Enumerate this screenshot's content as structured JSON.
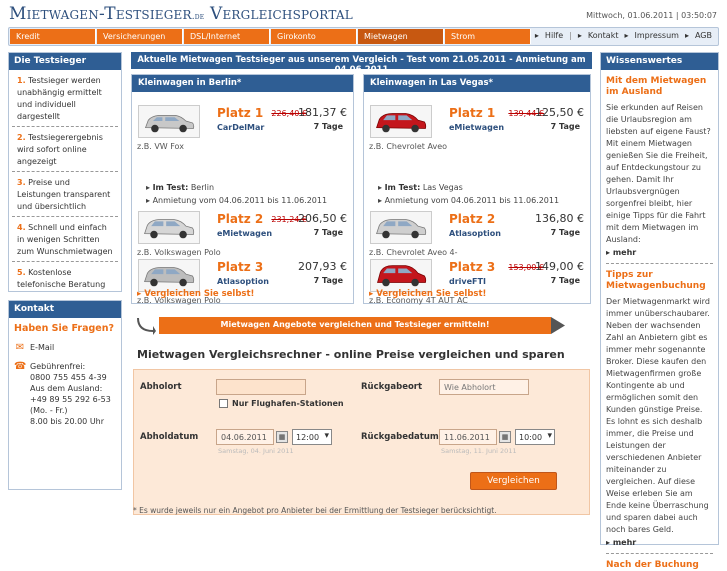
{
  "header": {
    "logo_main": "Mietwagen-Testsieger",
    "logo_tld": ".de",
    "logo_suffix": "Vergleichsportal",
    "datetime": "Mittwoch, 01.06.2011 | 03:50:07"
  },
  "nav": {
    "tabs": [
      "Kredit",
      "Versicherungen",
      "DSL/Internet",
      "Girokonto",
      "Mietwagen",
      "Strom"
    ],
    "active": "Mietwagen",
    "util": [
      "Hilfe",
      "Kontakt",
      "Impressum",
      "AGB"
    ]
  },
  "left": {
    "testsieger_title": "Die Testsieger",
    "tips": [
      {
        "num": "1.",
        "text": "Testsieger werden unabhängig ermittelt und individuell dargestellt"
      },
      {
        "num": "2.",
        "text": "Testsiegerergebnis wird sofort online angezeigt"
      },
      {
        "num": "3.",
        "text": "Preise und Leistungen transparent und übersichtlich"
      },
      {
        "num": "4.",
        "text": "Schnell und einfach in wenigen Schritten zum Wunschmietwagen"
      },
      {
        "num": "5.",
        "text": "Kostenlose telefonische Beratung"
      }
    ],
    "kontakt_title": "Kontakt",
    "question": "Haben Sie Fragen?",
    "email": "E-Mail",
    "phone": "Gebührenfrei:\n0800 755 455 4-39\nAus dem Ausland:\n+49 89 55 292 6-53\n(Mo. - Fr.)\n8.00 bis 20.00 Uhr"
  },
  "main": {
    "heading": "Aktuelle Mietwagen Testsieger aus unserem Vergleich - Test vom 21.05.2011 - Anmietung am 04.06.2011",
    "panels": [
      {
        "title": "Kleinwagen in Berlin*",
        "offers": [
          {
            "platz": "Platz 1",
            "old": "226,40 €",
            "price": "181,37 €",
            "vendor": "CarDelMar",
            "days": "7 Tage",
            "model": "z.B. VW Fox",
            "car_color": "#c8c8c8"
          },
          {
            "platz": "Platz 2",
            "old": "231,24 €",
            "price": "206,50 €",
            "vendor": "eMietwagen",
            "days": "7 Tage",
            "model": "z.B. Volkswagen Polo",
            "car_color": "#d6d6d6"
          },
          {
            "platz": "Platz 3",
            "old": "",
            "price": "207,93 €",
            "vendor": "Atlasoption",
            "days": "7 Tage",
            "model": "z.B. Volkswagen Polo",
            "car_color": "#bdbdbd"
          }
        ],
        "test_label": "Im Test:",
        "test_value": "Berlin",
        "rental": "Anmietung vom 04.06.2011 bis 11.06.2011",
        "compare": "Vergleichen Sie selbst!"
      },
      {
        "title": "Kleinwagen in Las Vegas*",
        "offers": [
          {
            "platz": "Platz 1",
            "old": "139,44 €",
            "price": "125,50 €",
            "vendor": "eMietwagen",
            "days": "7 Tage",
            "model": "z.B. Chevrolet Aveo",
            "car_color": "#c4161c"
          },
          {
            "platz": "Platz 2",
            "old": "",
            "price": "136,80 €",
            "vendor": "Atlasoption",
            "days": "7 Tage",
            "model": "z.B. Chevrolet Aveo 4-",
            "car_color": "#cfcfcf"
          },
          {
            "platz": "Platz 3",
            "old": "153,00 €",
            "price": "149,00 €",
            "vendor": "driveFTI",
            "days": "7 Tage",
            "model": "z.B. Economy 4T AUT AC",
            "car_color": "#c4161c"
          }
        ],
        "test_label": "Im Test:",
        "test_value": "Las Vegas",
        "rental": "Anmietung vom 04.06.2011 bis 11.06.2011",
        "compare": "Vergleichen Sie selbst!"
      }
    ],
    "ermitteln": "Mietwagen Angebote vergleichen und Testsieger ermitteln!",
    "rechner_title": "Mietwagen Vergleichsrechner - online Preise vergleichen und sparen",
    "form": {
      "abholort_label": "Abholort",
      "abholort_value": "",
      "flughafen_label": "Nur Flughafen-Stationen",
      "rueckgabeort_label": "Rückgabeort",
      "rueckgabeort_placeholder": "Wie Abholort",
      "abholdatum_label": "Abholdatum",
      "abholdatum_value": "04.06.2011",
      "abholzeit": "12:00",
      "abholdatum_hint": "Samstag, 04. Juni 2011",
      "rueckgabedatum_label": "Rückgabedatum",
      "rueckgabedatum_value": "11.06.2011",
      "rueckgabezeit": "10:00",
      "rueckgabedatum_hint": "Samstag, 11. Juni 2011",
      "submit": "Vergleichen"
    },
    "footnote": "* Es wurde jeweils nur ein Angebot pro Anbieter bei der Ermittlung der Testsieger berücksichtigt."
  },
  "right": {
    "title": "Wissenswertes",
    "sections": [
      {
        "heading": "Mit dem Mietwagen im Ausland",
        "text": "Sie erkunden auf Reisen die Urlaubsregion am liebsten auf eigene Faust? Mit einem Mietwagen genießen Sie die Freiheit, auf Entdeckungstour zu gehen. Damit Ihr Urlaubsvergnügen sorgenfrei bleibt, hier einige Tipps für die Fahrt mit dem Mietwagen im Ausland:",
        "more": "mehr"
      },
      {
        "heading": "Tipps zur Mietwagenbuchung",
        "text": "Der Mietwagenmarkt wird immer unüberschaubarer. Neben der wachsenden Zahl an Anbietern gibt es immer mehr sogenannte Broker. Diese kaufen den Mietwagenfirmen große Kontingente ab und ermöglichen somit den Kunden günstige Preise. Es lohnt es sich deshalb immer, die Preise und Leistungen der verschiedenen Anbieter miteinander zu vergleichen. Auf diese Weise erleben Sie am Ende keine Überraschung und sparen dabei auch noch bares Geld.",
        "more": "mehr"
      },
      {
        "heading": "Nach der Buchung",
        "text": "",
        "more": ""
      }
    ]
  }
}
